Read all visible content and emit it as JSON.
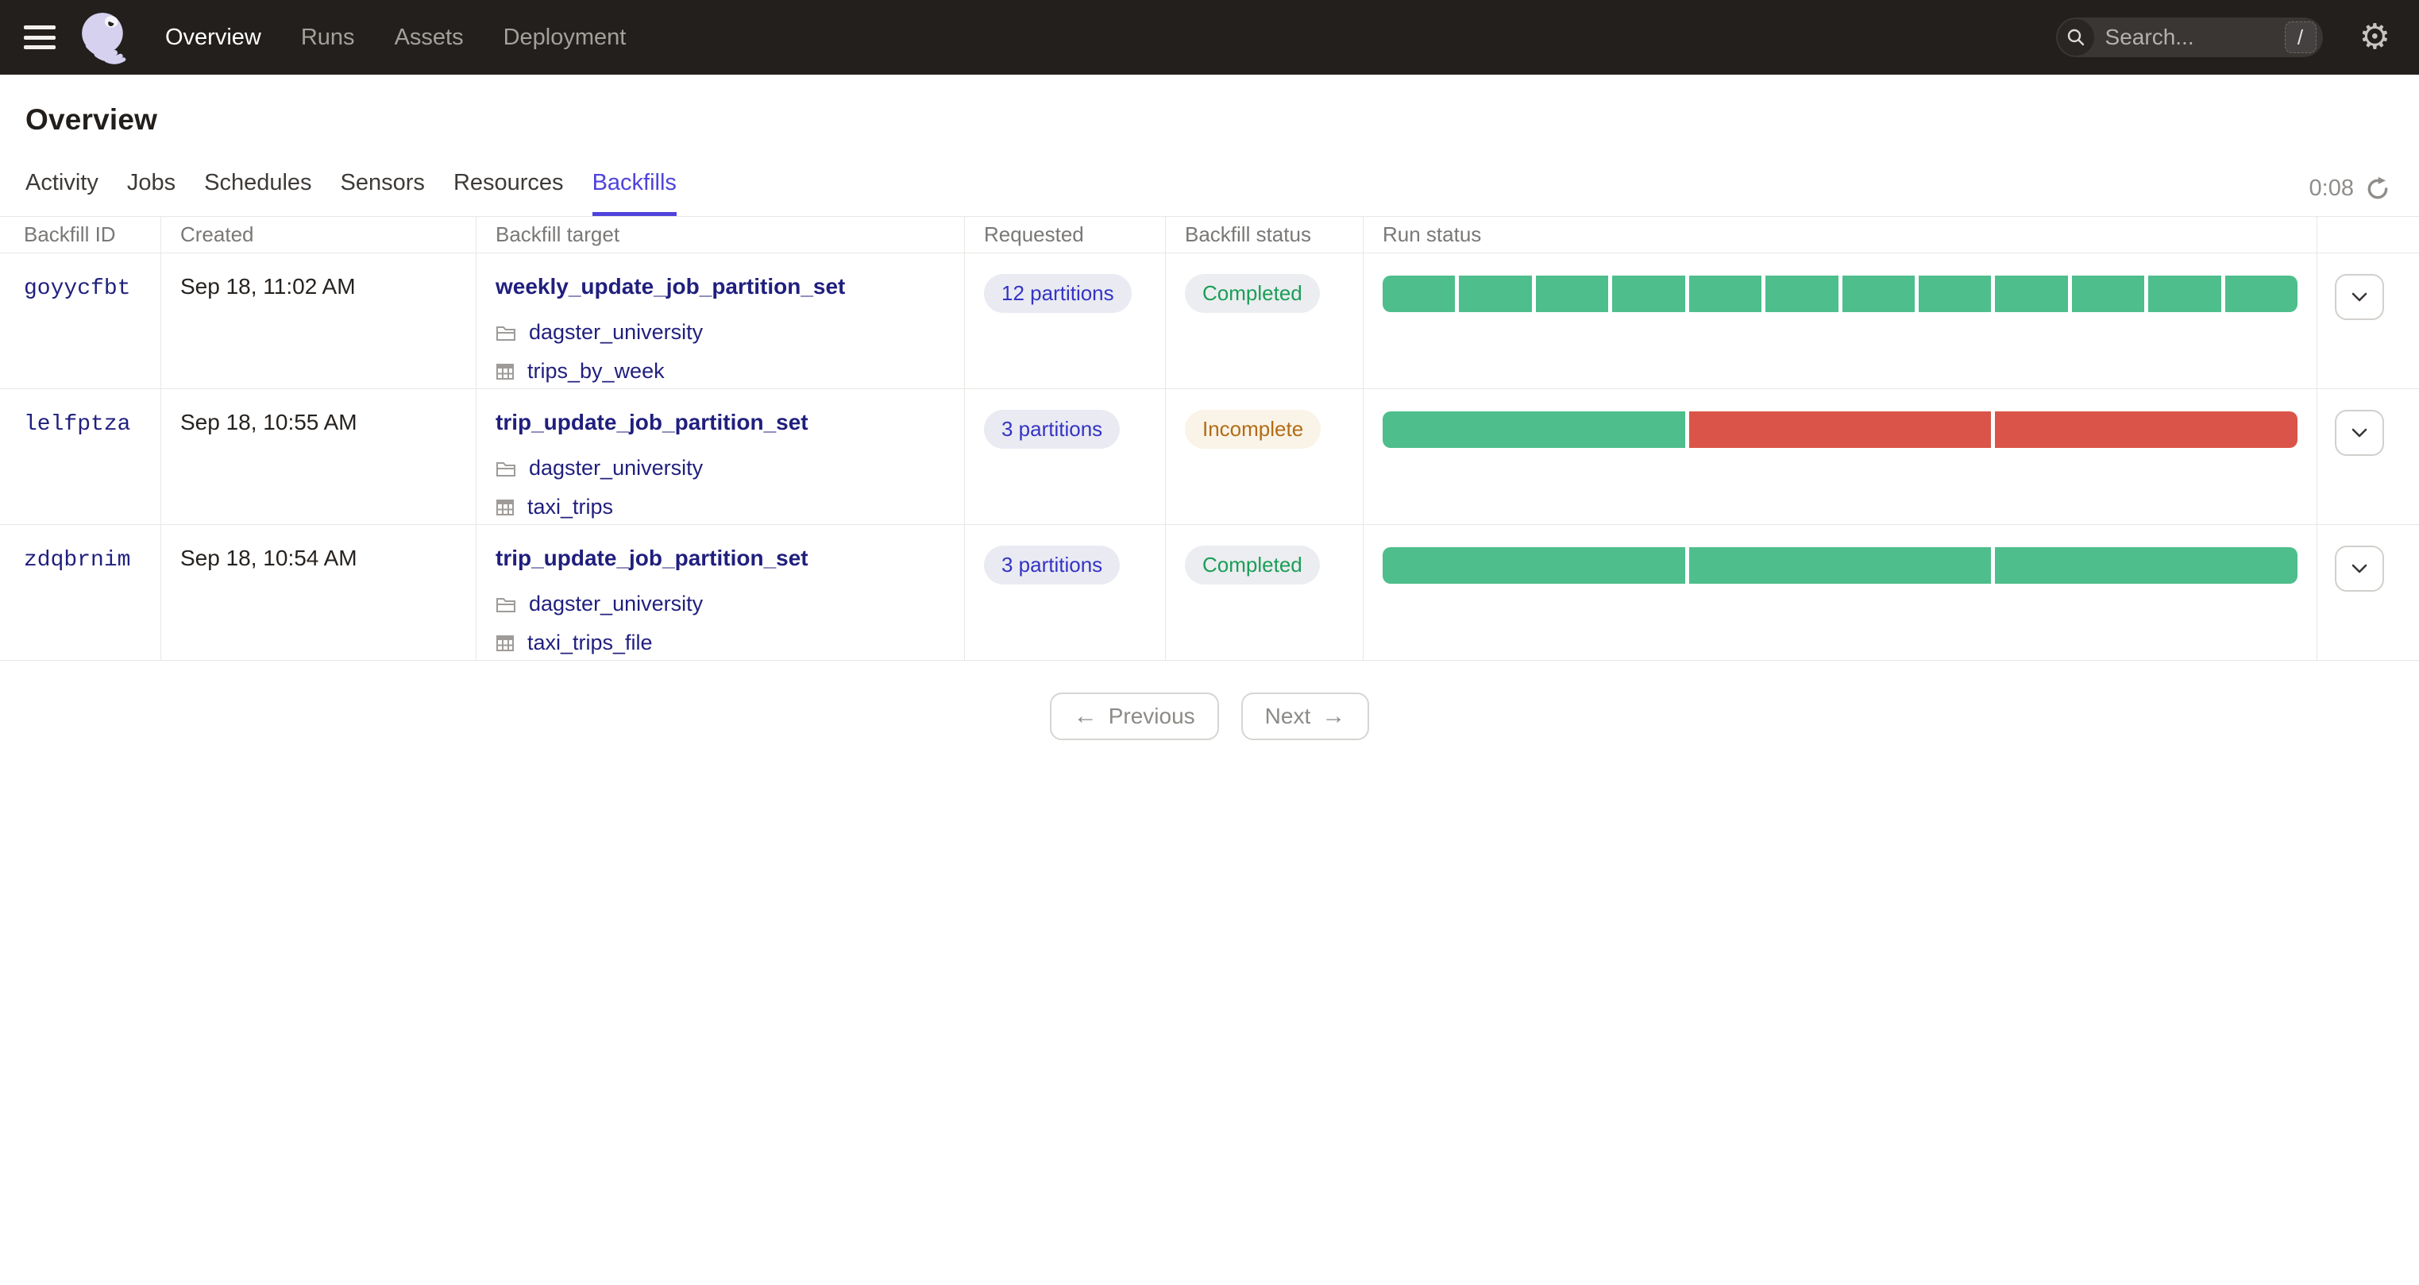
{
  "topnav": {
    "items": [
      {
        "label": "Overview",
        "active": true
      },
      {
        "label": "Runs",
        "active": false
      },
      {
        "label": "Assets",
        "active": false
      },
      {
        "label": "Deployment",
        "active": false
      }
    ],
    "search": {
      "placeholder": "Search...",
      "shortcut_key": "/"
    }
  },
  "icons": {
    "hamburger": "menu-icon",
    "logo": "dagster-logo",
    "search": "search-icon",
    "gear": "gear-icon",
    "refresh": "refresh-icon",
    "repo": "folder-icon",
    "asset": "table-grid-icon",
    "chevron": "chevron-down-icon",
    "prev_arrow": "←",
    "next_arrow": "→",
    "gear_glyph": "⚙"
  },
  "page": {
    "title": "Overview"
  },
  "tabs": [
    {
      "label": "Activity",
      "active": false
    },
    {
      "label": "Jobs",
      "active": false
    },
    {
      "label": "Schedules",
      "active": false
    },
    {
      "label": "Sensors",
      "active": false
    },
    {
      "label": "Resources",
      "active": false
    },
    {
      "label": "Backfills",
      "active": true
    }
  ],
  "refresh": {
    "countdown": "0:08"
  },
  "table": {
    "headers": [
      "Backfill ID",
      "Created",
      "Backfill target",
      "Requested",
      "Backfill status",
      "Run status"
    ],
    "rows": [
      {
        "id": "goyycfbt",
        "created": "Sep 18, 11:02 AM",
        "target": {
          "title": "weekly_update_job_partition_set",
          "repo": "dagster_university",
          "asset": "trips_by_week"
        },
        "requested": "12 partitions",
        "status": {
          "label": "Completed",
          "type": "success"
        },
        "segments": [
          "success",
          "success",
          "success",
          "success",
          "success",
          "success",
          "success",
          "success",
          "success",
          "success",
          "success",
          "success"
        ]
      },
      {
        "id": "lelfptza",
        "created": "Sep 18, 10:55 AM",
        "target": {
          "title": "trip_update_job_partition_set",
          "repo": "dagster_university",
          "asset": "taxi_trips"
        },
        "requested": "3 partitions",
        "status": {
          "label": "Incomplete",
          "type": "warning"
        },
        "segments": [
          "success",
          "failure",
          "failure"
        ]
      },
      {
        "id": "zdqbrnim",
        "created": "Sep 18, 10:54 AM",
        "target": {
          "title": "trip_update_job_partition_set",
          "repo": "dagster_university",
          "asset": "taxi_trips_file"
        },
        "requested": "3 partitions",
        "status": {
          "label": "Completed",
          "type": "success"
        },
        "segments": [
          "success",
          "success",
          "success"
        ]
      }
    ]
  },
  "pagination": {
    "previous": "Previous",
    "next": "Next"
  },
  "colors": {
    "topbar_bg": "#231f1d",
    "accent_blurple": "#4f43dd",
    "link_navy": "#201f7e",
    "run_success": "#4dbe8c",
    "run_failure": "#db5449",
    "badge_requested_text": "#3434c4",
    "status_completed_text": "#1a9e58",
    "status_incomplete_text": "#b26c15"
  }
}
